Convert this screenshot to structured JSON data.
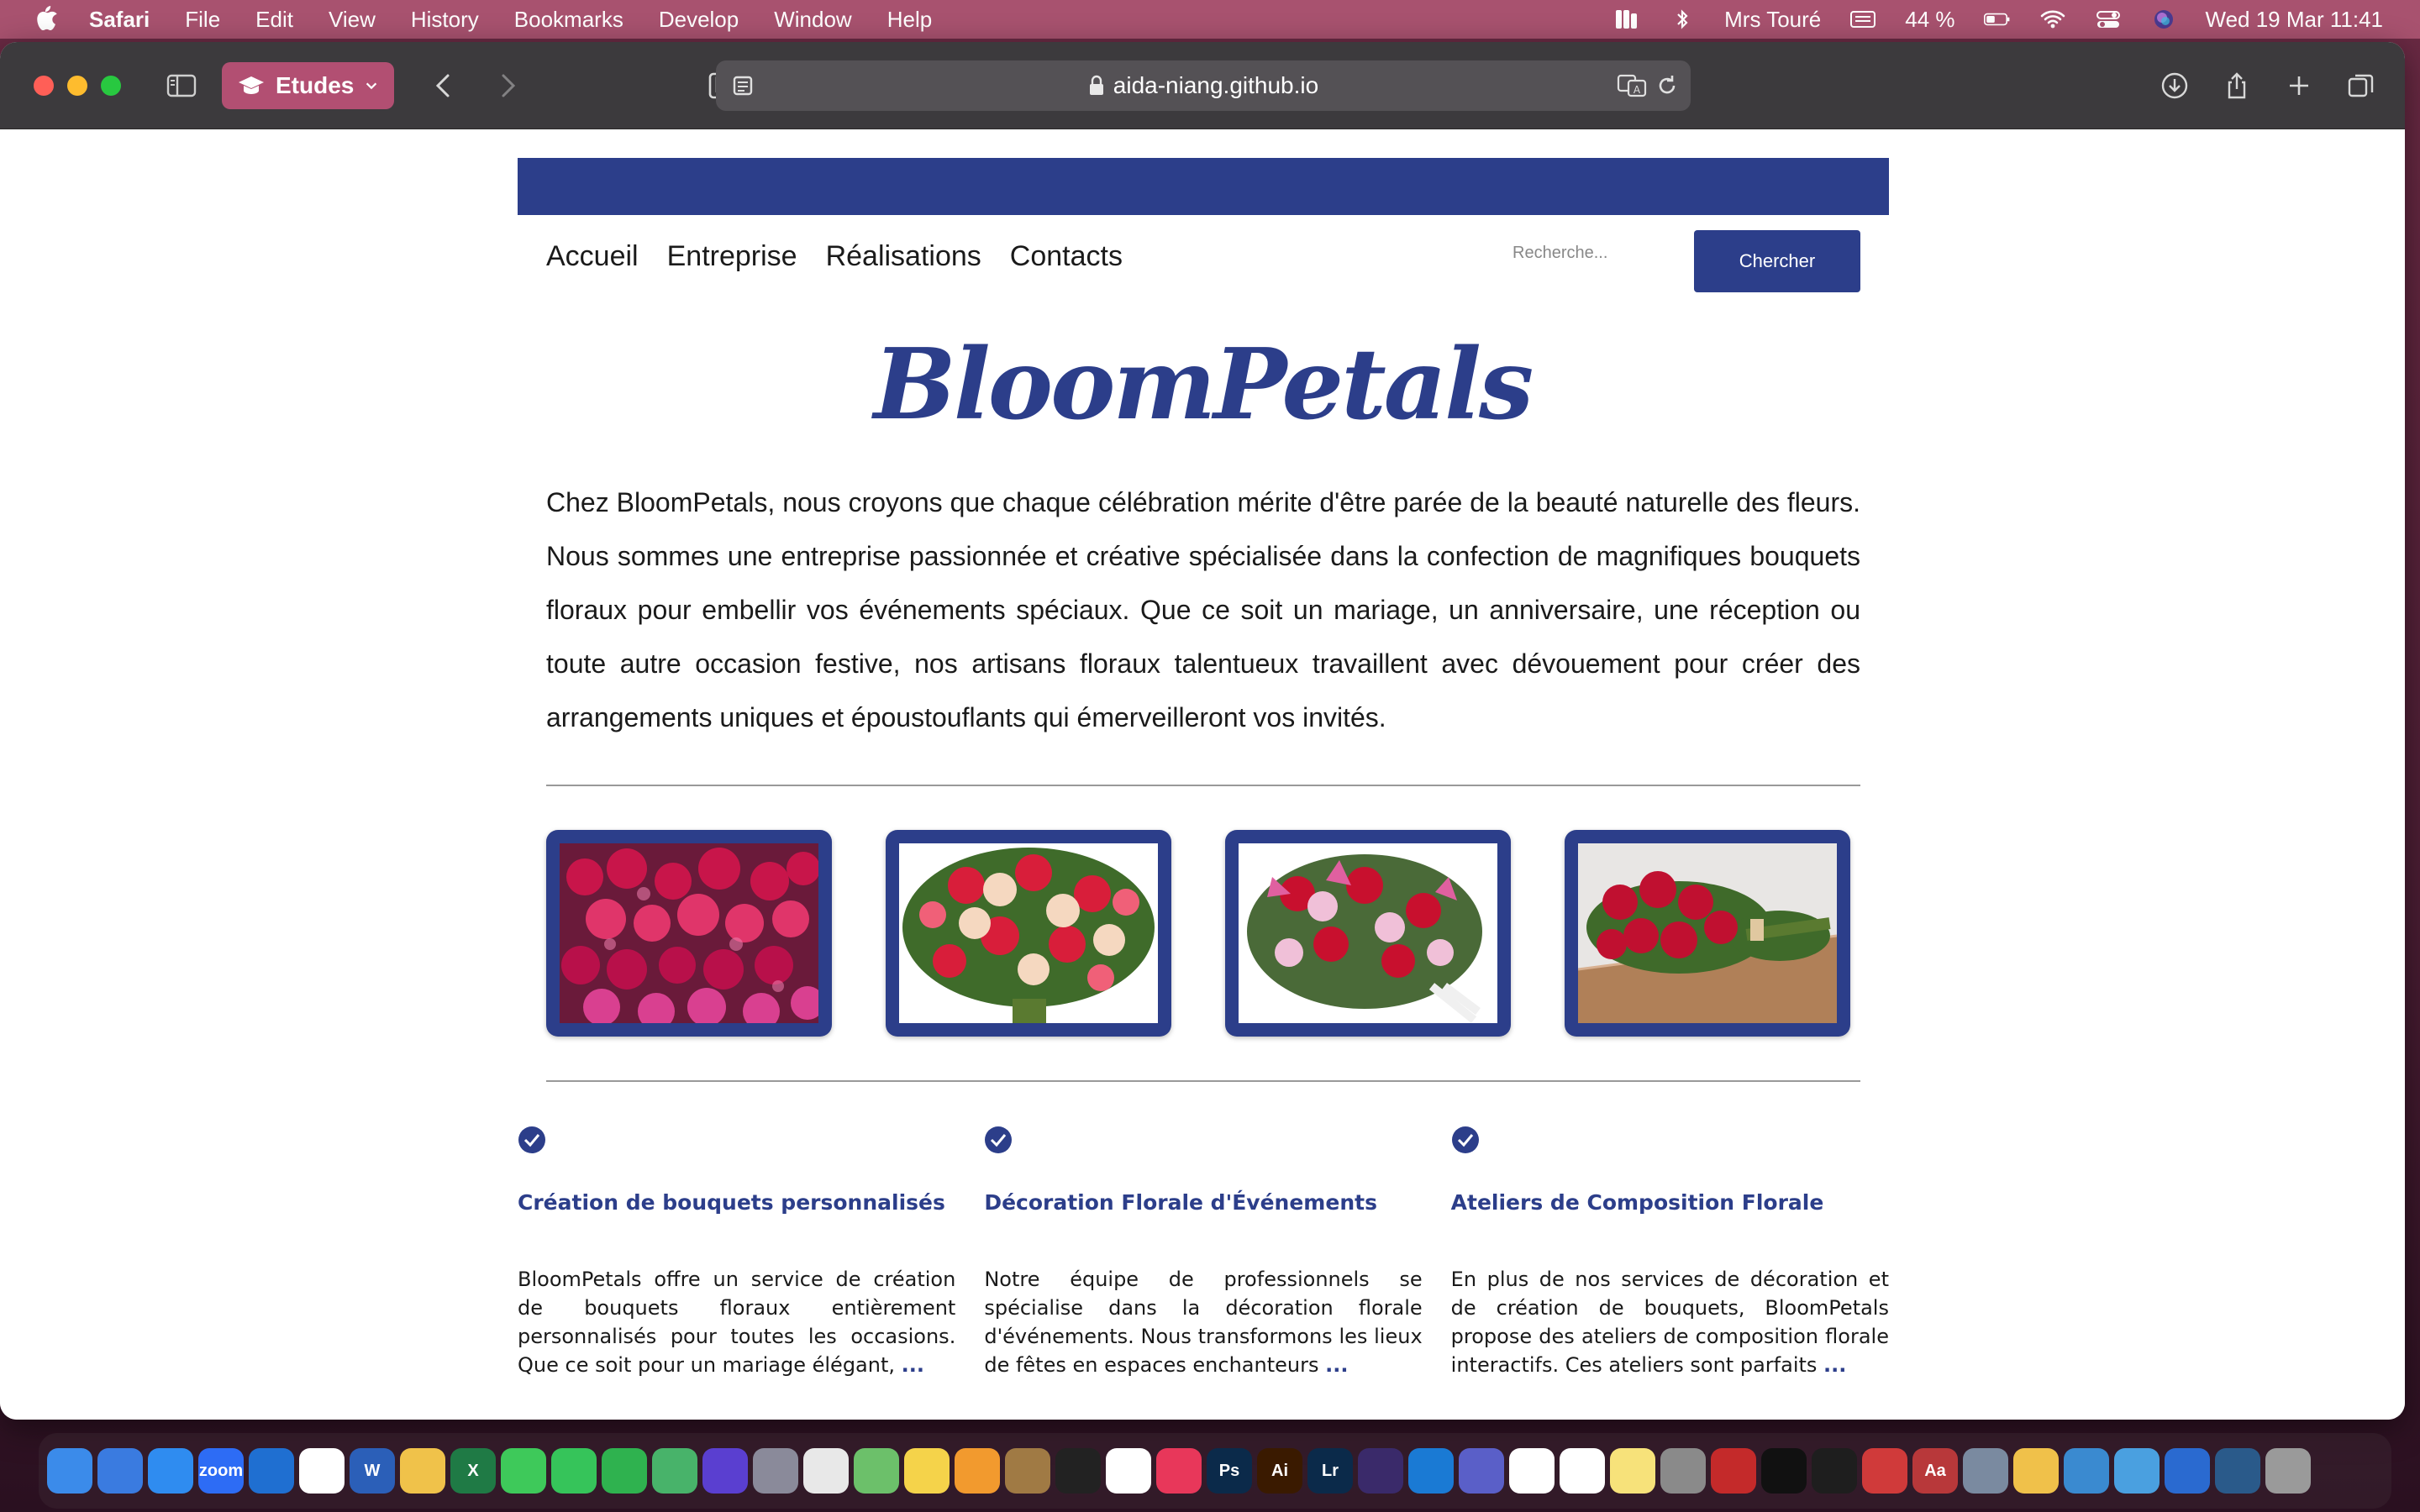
{
  "menubar": {
    "app_name": "Safari",
    "menus": [
      "File",
      "Edit",
      "View",
      "History",
      "Bookmarks",
      "Develop",
      "Window",
      "Help"
    ],
    "user": "Mrs Touré",
    "battery": "44 %",
    "datetime": "Wed 19 Mar  11:41"
  },
  "browser": {
    "tab_group": "Etudes",
    "url": "aida-niang.github.io"
  },
  "site": {
    "nav": [
      "Accueil",
      "Entreprise",
      "Réalisations",
      "Contacts"
    ],
    "search_placeholder": "Recherche...",
    "search_button": "Chercher",
    "logo": "BloomPetals",
    "intro": "Chez BloomPetals, nous croyons que chaque célébration mérite d'être parée de la beauté naturelle des fleurs. Nous sommes une entreprise passionnée et créative spécialisée dans la confection de magnifiques bouquets floraux pour embellir vos événements spéciaux. Que ce soit un mariage, un anniversaire, une réception ou toute autre occasion festive, nos artisans floraux talentueux travaillent avec dévouement pour créer des arrangements uniques et époustouflants qui émerveilleront vos invités.",
    "gallery": [
      "pink-red-roses-bouquet",
      "mixed-roses-bouquet",
      "lilies-roses-bouquet",
      "red-roses-on-table"
    ],
    "features": [
      {
        "title": "Création de bouquets personnalisés",
        "text": "BloomPetals offre un service de création de bouquets floraux entièrement personnalisés pour toutes les occasions. Que ce soit pour un mariage élégant,",
        "more": "..."
      },
      {
        "title": "Décoration Florale d'Événements",
        "text": "Notre équipe de professionnels se spécialise dans la décoration florale d'événements. Nous transformons les lieux de fêtes en espaces enchanteurs",
        "more": "..."
      },
      {
        "title": "Ateliers de Composition Florale",
        "text": "En plus de nos services de décoration et de création de bouquets, BloomPetals propose des ateliers de composition florale interactifs. Ces ateliers sont parfaits",
        "more": "..."
      }
    ]
  },
  "colors": {
    "brand": "#2c3e8a",
    "menubar": "#a8526f",
    "toolbar": "#3c3a3d"
  },
  "dock": {
    "apps": [
      {
        "name": "finder-icon",
        "color": "#3b8bea",
        "label": ""
      },
      {
        "name": "mail-icon",
        "color": "#3a7be0",
        "label": ""
      },
      {
        "name": "safari-icon",
        "color": "#2f8cf0",
        "label": ""
      },
      {
        "name": "zoom-icon",
        "color": "#2d6cf5",
        "label": "zoom"
      },
      {
        "name": "trello-icon",
        "color": "#1f6fd1",
        "label": ""
      },
      {
        "name": "slack-icon",
        "color": "#ffffff",
        "label": ""
      },
      {
        "name": "word-icon",
        "color": "#2b5fb8",
        "label": "W"
      },
      {
        "name": "photos-icon",
        "color": "#f0c24a",
        "label": ""
      },
      {
        "name": "excel-icon",
        "color": "#1f7a45",
        "label": "X"
      },
      {
        "name": "messages-icon",
        "color": "#3ec95a",
        "label": ""
      },
      {
        "name": "facetime-icon",
        "color": "#36c45a",
        "label": ""
      },
      {
        "name": "numbers-icon",
        "color": "#2fb24f",
        "label": ""
      },
      {
        "name": "find-my-icon",
        "color": "#48b36a",
        "label": ""
      },
      {
        "name": "siri-icon",
        "color": "#5a3fd0",
        "label": ""
      },
      {
        "name": "launchpad-icon",
        "color": "#8a8a9a",
        "label": ""
      },
      {
        "name": "chrome-icon",
        "color": "#e8e8e8",
        "label": ""
      },
      {
        "name": "maps-icon",
        "color": "#6cc06a",
        "label": ""
      },
      {
        "name": "notes-icon",
        "color": "#f5d34a",
        "label": ""
      },
      {
        "name": "pages-icon",
        "color": "#f29a2e",
        "label": ""
      },
      {
        "name": "keka-icon",
        "color": "#a07a44",
        "label": ""
      },
      {
        "name": "voice-memos-icon",
        "color": "#222222",
        "label": ""
      },
      {
        "name": "freeform-icon",
        "color": "#ffffff",
        "label": ""
      },
      {
        "name": "creative-cloud-icon",
        "color": "#e8375a",
        "label": ""
      },
      {
        "name": "photoshop-icon",
        "color": "#0b2a4a",
        "label": "Ps"
      },
      {
        "name": "illustrator-icon",
        "color": "#3a1a00",
        "label": "Ai"
      },
      {
        "name": "lightroom-icon",
        "color": "#0b2a4a",
        "label": "Lr"
      },
      {
        "name": "screen-tool-icon",
        "color": "#3a2a6a",
        "label": ""
      },
      {
        "name": "vscode-icon",
        "color": "#1a7ad4",
        "label": ""
      },
      {
        "name": "teams-icon",
        "color": "#5a5fc8",
        "label": ""
      },
      {
        "name": "calendar-icon",
        "color": "#ffffff",
        "label": ""
      },
      {
        "name": "reminders-icon",
        "color": "#ffffff",
        "label": ""
      },
      {
        "name": "notes-alt-icon",
        "color": "#f7e27a",
        "label": ""
      },
      {
        "name": "system-settings-icon",
        "color": "#8a8a8a",
        "label": ""
      },
      {
        "name": "filezilla-icon",
        "color": "#c42a2a",
        "label": ""
      },
      {
        "name": "audio-app-icon",
        "color": "#111111",
        "label": ""
      },
      {
        "name": "terminal-icon",
        "color": "#1e1e1e",
        "label": ""
      },
      {
        "name": "remote-icon",
        "color": "#d03a3a",
        "label": ""
      },
      {
        "name": "dictionary-icon",
        "color": "#b8383a",
        "label": "Aa"
      },
      {
        "name": "preview-icon",
        "color": "#7a8aa0",
        "label": ""
      },
      {
        "name": "script-editor-icon",
        "color": "#f0c14a",
        "label": ""
      },
      {
        "name": "network-icon",
        "color": "#3a8ad0",
        "label": ""
      },
      {
        "name": "keychain-icon",
        "color": "#4aa0e0",
        "label": ""
      },
      {
        "name": "xcode-icon",
        "color": "#2a6ad0",
        "label": ""
      },
      {
        "name": "mysql-workbench-icon",
        "color": "#2a5a8a",
        "label": ""
      },
      {
        "name": "trash-icon",
        "color": "#9a9a9a",
        "label": ""
      }
    ]
  }
}
